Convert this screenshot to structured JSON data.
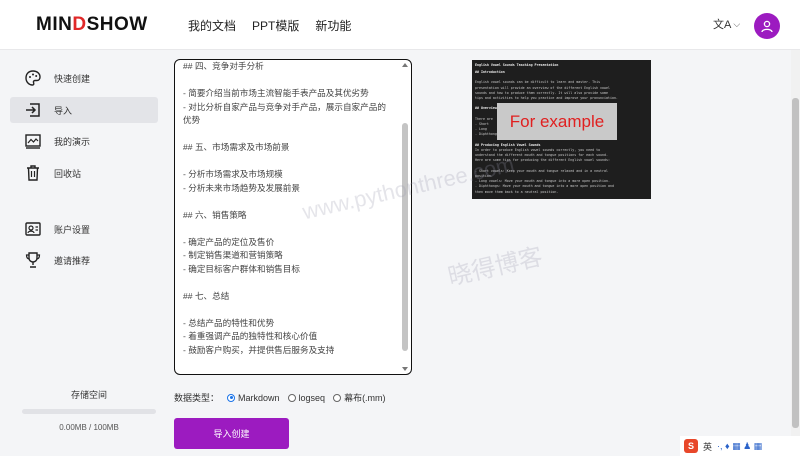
{
  "app": {
    "logo_left": "MIN",
    "logo_accent": "D",
    "logo_right": "SHOW"
  },
  "nav": {
    "items": [
      "我的文档",
      "PPT模版",
      "新功能"
    ]
  },
  "lang_icon_glyph": "文A",
  "sidebar": {
    "items": [
      {
        "label": "快速创建",
        "icon": "palette-icon"
      },
      {
        "label": "导入",
        "icon": "import-icon"
      },
      {
        "label": "我的演示",
        "icon": "presentation-icon"
      },
      {
        "label": "回收站",
        "icon": "trash-icon"
      },
      {
        "label": "账户设置",
        "icon": "account-settings-icon"
      },
      {
        "label": "邀请推荐",
        "icon": "trophy-icon"
      }
    ],
    "storage_title": "存储空间",
    "storage_text": "0.00MB / 100MB",
    "storage_used_fraction": 0
  },
  "editor": {
    "lines": [
      "## 四、竞争对手分析",
      "",
      "- 简要介绍当前市场主流智能手表产品及其优劣势",
      "- 对比分析自家产品与竞争对手产品，展示自家产品的",
      "优势",
      "",
      "## 五、市场需求及市场前景",
      "",
      "- 分析市场需求及市场规模",
      "- 分析未来市场趋势及发展前景",
      "",
      "## 六、销售策略",
      "",
      "- 确定产品的定位及售价",
      "- 制定销售渠道和营销策略",
      "- 确定目标客户群体和销售目标",
      "",
      "## 七、总结",
      "",
      "- 总结产品的特性和优势",
      "- 着重强调产品的独特性和核心价值",
      "- 鼓励客户购买，并提供售后服务及支持"
    ]
  },
  "datatype": {
    "label": "数据类型：",
    "options": [
      {
        "label": "Markdown",
        "selected": true
      },
      {
        "label": "logseq",
        "selected": false
      },
      {
        "label": "幕布(.mm)",
        "selected": false
      }
    ]
  },
  "import_button": "导入创建",
  "preview": {
    "title": "English Vowel Sounds Teaching Presentation",
    "overlay": "For example",
    "lines": [
      {
        "t": "## Introduction",
        "cls": "h"
      },
      {
        "t": "",
        "cls": ""
      },
      {
        "t": "English vowel sounds can be difficult to learn and master. This",
        "cls": ""
      },
      {
        "t": "presentation will provide an overview of the different English vowel",
        "cls": ""
      },
      {
        "t": "sounds and how to produce them correctly. It will also provide some",
        "cls": ""
      },
      {
        "t": "tips and activities to help you practice and improve your pronunciation.",
        "cls": ""
      },
      {
        "t": "",
        "cls": ""
      },
      {
        "t": "## Overview of English Vowel Sounds",
        "cls": "h"
      },
      {
        "t": "",
        "cls": ""
      },
      {
        "t": "There are",
        "cls": ""
      },
      {
        "t": "- Short",
        "cls": ""
      },
      {
        "t": "- Long",
        "cls": ""
      },
      {
        "t": "- Diphthongs",
        "cls": ""
      },
      {
        "t": "",
        "cls": ""
      },
      {
        "t": "## Producing English Vowel Sounds",
        "cls": "h"
      },
      {
        "t": "In order to produce English vowel sounds correctly, you need to",
        "cls": ""
      },
      {
        "t": "understand the different mouth and tongue positions for each sound.",
        "cls": ""
      },
      {
        "t": "Here are some tips for producing the different English vowel sounds:",
        "cls": ""
      },
      {
        "t": "",
        "cls": ""
      },
      {
        "t": "- Short vowels: Keep your mouth and tongue relaxed and in a neutral",
        "cls": ""
      },
      {
        "t": "position.",
        "cls": ""
      },
      {
        "t": "- Long vowels: Move your mouth and tongue into a more open position.",
        "cls": ""
      },
      {
        "t": "- Diphthongs: Move your mouth and tongue into a more open position and",
        "cls": ""
      },
      {
        "t": "then move them back to a neutral position.",
        "cls": ""
      }
    ]
  },
  "watermark": {
    "url": "www.pythonthree.com",
    "cn": "晓得博客"
  },
  "ime": {
    "s": "S",
    "lang": "英",
    "icons": "·, ♦ ▦ ♟ ▦"
  },
  "colors": {
    "accent": "#9c1bc0",
    "logo_red": "#e02828",
    "radio_blue": "#1a73e8"
  }
}
